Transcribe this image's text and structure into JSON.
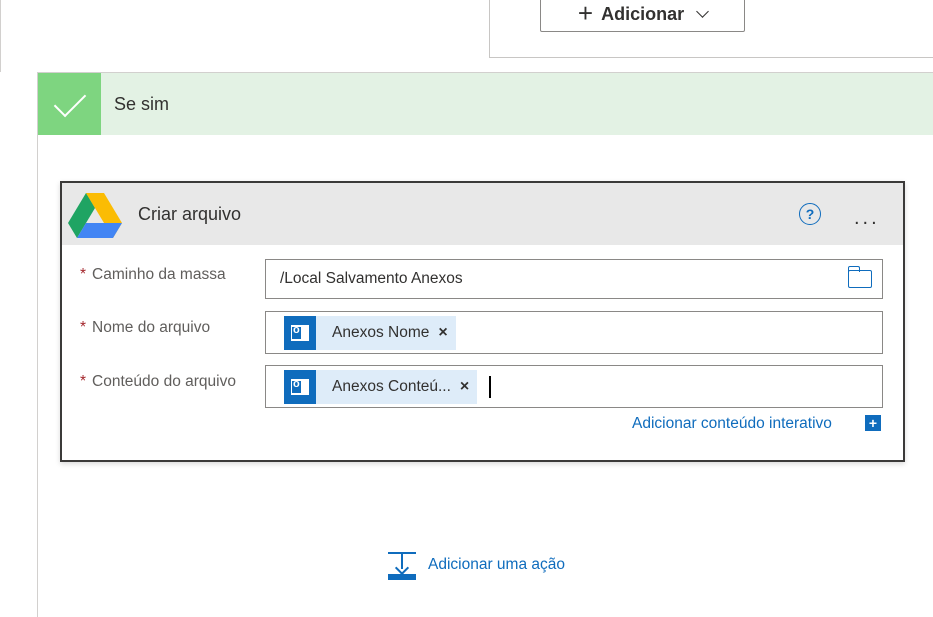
{
  "top": {
    "add_label": "Adicionar"
  },
  "branch": {
    "title": "Se sim"
  },
  "action": {
    "title": "Criar arquivo",
    "help_symbol": "?",
    "more_symbol": "...",
    "fields": {
      "path_label": "Caminho da massa",
      "path_value": "/Local Salvamento Anexos",
      "name_label": "Nome do arquivo",
      "name_token": "Anexos Nome",
      "content_label": "Conteúdo do arquivo",
      "content_token": "Anexos Conteú...",
      "required_mark": "*",
      "remove_symbol": "×"
    },
    "dynamic_content_link": "Adicionar conteúdo interativo",
    "dynamic_plus": "+"
  },
  "add_action": {
    "label": "Adicionar uma ação"
  },
  "colors": {
    "accent": "#0f6cbd",
    "success_header": "#e3f2e4",
    "success_check": "#7ed580",
    "token_bg": "#deecf9",
    "required": "#a4262c"
  },
  "icons": [
    "plus-icon",
    "chevron-down-icon",
    "checkmark-icon",
    "google-drive-icon",
    "help-icon",
    "more-icon",
    "folder-icon",
    "outlook-icon",
    "add-action-icon"
  ]
}
